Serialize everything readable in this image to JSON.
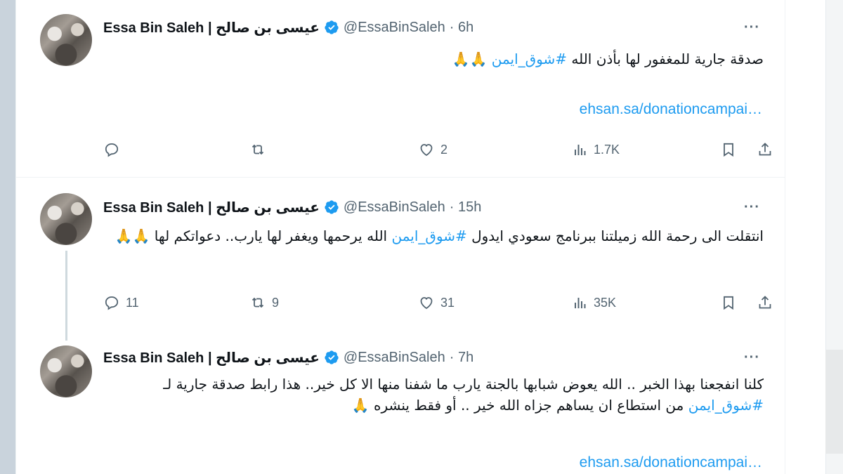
{
  "tweets": [
    {
      "name": "Essa Bin Saleh | عيسى بن صالح",
      "handle": "@EssaBinSaleh",
      "time": "· 6h",
      "text_before": "صدقة جارية للمغفور لها بأذن الله ",
      "hashtag": "#شوق_ايمن",
      "text_after": " 🙏🙏",
      "link": "ehsan.sa/donationcampai…",
      "replies": "",
      "retweets": "",
      "likes": "2",
      "views": "1.7K"
    },
    {
      "name": "Essa Bin Saleh | عيسى بن صالح",
      "handle": "@EssaBinSaleh",
      "time": "· 15h",
      "text_before": "انتقلت الى رحمة الله زميلتنا ببرنامج سعودي ايدول ",
      "hashtag": "#شوق_ايمن",
      "text_after": " الله يرحمها ويغفر لها يارب.. دعواتكم لها 🙏🙏",
      "replies": "11",
      "retweets": "9",
      "likes": "31",
      "views": "35K"
    },
    {
      "name": "Essa Bin Saleh | عيسى بن صالح",
      "handle": "@EssaBinSaleh",
      "time": "· 7h",
      "text_before": "كلنا انفجعنا بهذا الخبر .. الله يعوض شبابها بالجنة يارب ما شفنا منها الا كل خير.. هذا رابط صدقة جارية لـ ",
      "hashtag": "#شوق_ايمن",
      "text_after": " من استطاع ان يساهم جزاه الله خير .. أو فقط ينشره 🙏",
      "link": "ehsan.sa/donationcampai…"
    }
  ],
  "more_label": "···",
  "colors": {
    "accent": "#1d9bf0",
    "muted": "#536471",
    "text": "#0f1419"
  },
  "icons": [
    "reply-icon",
    "retweet-icon",
    "like-icon",
    "views-icon",
    "bookmark-icon",
    "share-icon",
    "verified-badge-icon",
    "more-icon"
  ]
}
